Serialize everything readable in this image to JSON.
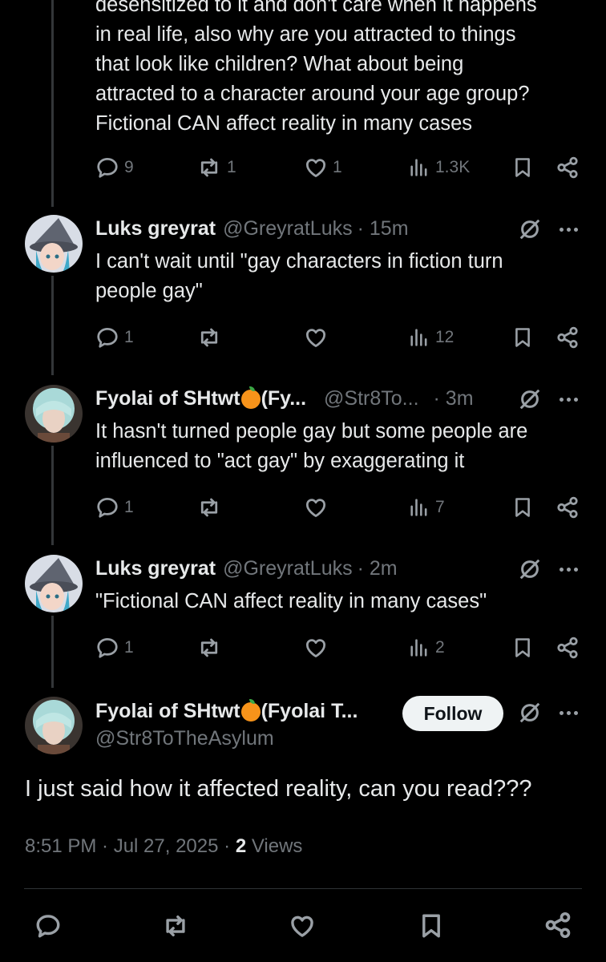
{
  "prev_tweet": {
    "lines": [
      "desensitized to it and don't care when it happens",
      "in real life, also why are you attracted to things",
      "that look like children? What about being",
      "attracted to a character around your age group?",
      "Fictional CAN affect reality in many cases"
    ],
    "replies": "9",
    "reposts": "1",
    "likes": "1",
    "views": "1.3K"
  },
  "replies": [
    {
      "name": "Luks greyrat",
      "handle": "@GreyratLuks",
      "time": "· 15m",
      "lines": [
        "I can't wait until \"gay characters in fiction turn",
        "people gay\""
      ],
      "replies": "1",
      "reposts": "",
      "likes": "",
      "views": "12"
    },
    {
      "name": "Fyolai of SHtwt",
      "name_suffix": "(Fy...",
      "handle": "@Str8To...",
      "time": "· 3m",
      "lines": [
        "It hasn't turned people gay but some people are",
        "influenced to \"act gay\" by exaggerating it"
      ],
      "replies": "1",
      "reposts": "",
      "likes": "",
      "views": "7"
    },
    {
      "name": "Luks greyrat",
      "handle": "@GreyratLuks",
      "time": "· 2m",
      "lines": [
        "\"Fictional CAN affect reality in many cases\""
      ],
      "replies": "1",
      "reposts": "",
      "likes": "",
      "views": "2"
    }
  ],
  "main_tweet": {
    "name": "Fyolai of SHtwt",
    "name_suffix": "(Fyolai T...",
    "handle": "@Str8ToTheAsylum",
    "follow_label": "Follow",
    "text": "I just said how it affected reality, can you read???",
    "time": "8:51 PM · Jul 27, 2025 · ",
    "views_count": "2",
    "views_label": " Views"
  },
  "colors": {
    "background": "#000000",
    "text": "#e7e9ea",
    "muted": "#71767b",
    "accent_orange": "#f7931a"
  },
  "icons": [
    "reply-icon",
    "repost-icon",
    "like-icon",
    "views-icon",
    "bookmark-icon",
    "share-icon",
    "grok-icon",
    "more-icon"
  ]
}
